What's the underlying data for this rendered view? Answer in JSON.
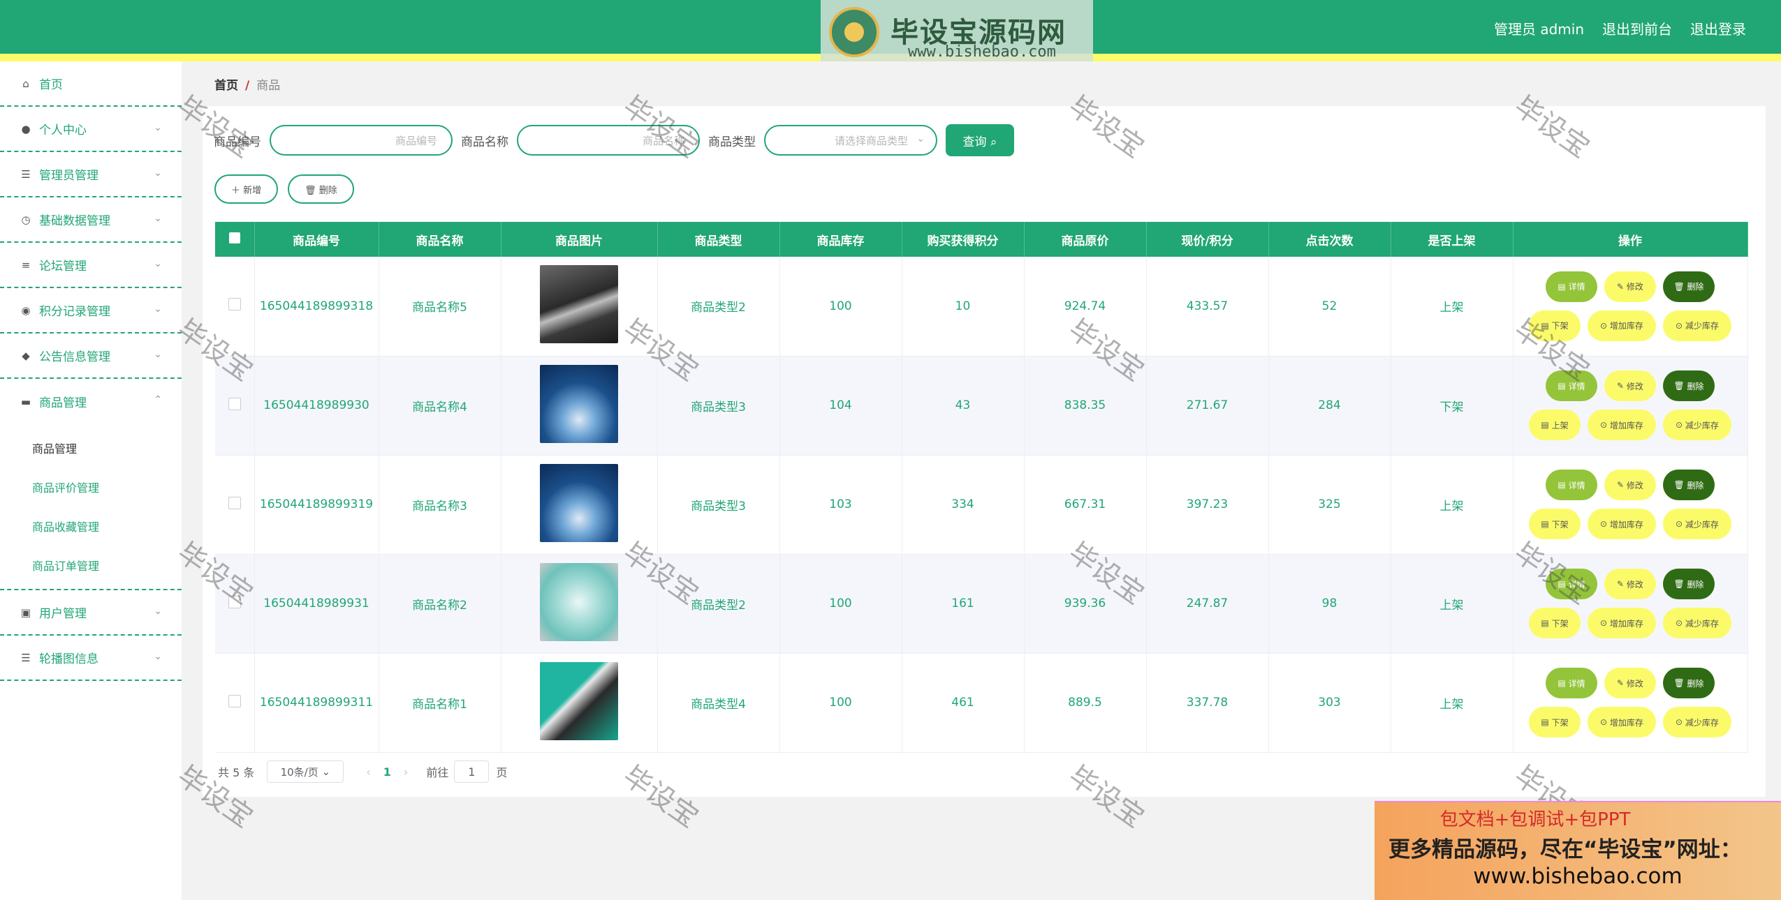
{
  "header": {
    "brand_title": "毕设宝源码网",
    "brand_url": "www.bishebao.com",
    "user": "管理员 admin",
    "front_link": "退出到前台",
    "logout": "退出登录"
  },
  "sidebar": {
    "items": [
      {
        "label": "首页",
        "icon": "home-icon",
        "glyph": "⌂"
      },
      {
        "label": "个人中心",
        "icon": "user-icon",
        "glyph": "●"
      },
      {
        "label": "管理员管理",
        "icon": "list-icon",
        "glyph": "☰"
      },
      {
        "label": "基础数据管理",
        "icon": "clock-icon",
        "glyph": "◷"
      },
      {
        "label": "论坛管理",
        "icon": "sliders-icon",
        "glyph": "≡"
      },
      {
        "label": "积分记录管理",
        "icon": "mic-icon",
        "glyph": "◉"
      },
      {
        "label": "公告信息管理",
        "icon": "pin-icon",
        "glyph": "◆"
      },
      {
        "label": "商品管理",
        "icon": "briefcase-icon",
        "glyph": "▬"
      },
      {
        "label": "用户管理",
        "icon": "usergroup-icon",
        "glyph": "▣"
      },
      {
        "label": "轮播图信息",
        "icon": "menu-icon",
        "glyph": "☰"
      }
    ],
    "sub_items": [
      "商品管理",
      "商品评价管理",
      "商品收藏管理",
      "商品订单管理"
    ]
  },
  "breadcrumb": {
    "home": "首页",
    "sep": "/",
    "current": "商品"
  },
  "search": {
    "label_code": "商品编号",
    "ph_code": "商品编号",
    "label_name": "商品名称",
    "ph_name": "商品名称",
    "label_type": "商品类型",
    "ph_type": "请选择商品类型",
    "query": "查询 ⌕"
  },
  "actions": {
    "add": "＋ 新增",
    "delete": "🗑 删除"
  },
  "table": {
    "headers": [
      "商品编号",
      "商品名称",
      "商品图片",
      "商品类型",
      "商品库存",
      "购买获得积分",
      "商品原价",
      "现价/积分",
      "点击次数",
      "是否上架",
      "操作"
    ],
    "rows": [
      {
        "code": "165044189899318",
        "name": "商品名称5",
        "img": "laptop-dark",
        "type": "商品类型2",
        "stock": "100",
        "points": "10",
        "orig": "924.74",
        "now": "433.57",
        "clicks": "52",
        "shelf": "上架",
        "shelf_btn": "下架"
      },
      {
        "code": "16504418989930",
        "name": "商品名称4",
        "img": "cosmetic-blue",
        "type": "商品类型3",
        "stock": "104",
        "points": "43",
        "orig": "838.35",
        "now": "271.67",
        "clicks": "284",
        "shelf": "下架",
        "shelf_btn": "上架"
      },
      {
        "code": "165044189899319",
        "name": "商品名称3",
        "img": "cosmetic-blue",
        "type": "商品类型3",
        "stock": "103",
        "points": "334",
        "orig": "667.31",
        "now": "397.23",
        "clicks": "325",
        "shelf": "上架",
        "shelf_btn": "下架"
      },
      {
        "code": "16504418989931",
        "name": "商品名称2",
        "img": "plastic-box",
        "type": "商品类型2",
        "stock": "100",
        "points": "161",
        "orig": "939.36",
        "now": "247.87",
        "clicks": "98",
        "shelf": "上架",
        "shelf_btn": "下架"
      },
      {
        "code": "165044189899311",
        "name": "商品名称1",
        "img": "laptop-teal",
        "type": "商品类型4",
        "stock": "100",
        "points": "461",
        "orig": "889.5",
        "now": "337.78",
        "clicks": "303",
        "shelf": "上架",
        "shelf_btn": "下架"
      }
    ],
    "op_labels": {
      "detail": "详情",
      "edit": "修改",
      "del": "删除",
      "inc": "增加库存",
      "dec": "减少库存"
    }
  },
  "pager": {
    "total": "共 5 条",
    "size": "10条/页",
    "prev": "‹",
    "page": "1",
    "next": "›",
    "goto": "前往",
    "jump": "1",
    "page_unit": "页"
  },
  "watermark": "毕设宝",
  "ad": {
    "line1": "包文档+包调试+包PPT",
    "line2": "更多精品源码，尽在“毕设宝”网址：",
    "line3": "www.bishebao.com"
  },
  "colors": {
    "accent": "#21a675",
    "stripe": "#fbfb6a",
    "danger": "#2f6b14",
    "detail": "#93c43a"
  }
}
